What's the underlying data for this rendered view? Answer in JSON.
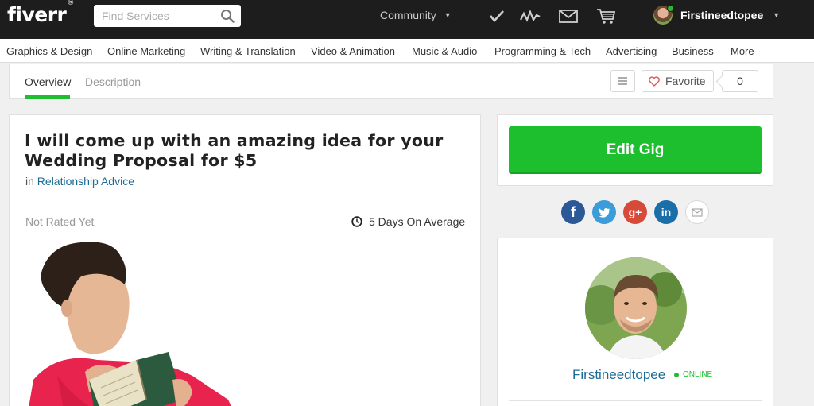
{
  "topbar": {
    "logo": "fiverr",
    "logo_mark": "®",
    "search_placeholder": "Find Services",
    "community": "Community",
    "username": "Firstineedtopee",
    "icons": [
      "search-icon",
      "checkmark-icon",
      "activity-icon",
      "inbox-icon",
      "cart-icon"
    ]
  },
  "categories": [
    "Graphics & Design",
    "Online Marketing",
    "Writing & Translation",
    "Video & Animation",
    "Music & Audio",
    "Programming & Tech",
    "Advertising",
    "Business",
    "More"
  ],
  "tabs": {
    "overview": "Overview",
    "description": "Description",
    "favorite": "Favorite",
    "favorite_count": "0"
  },
  "gig": {
    "title": "I will come up with an amazing idea for your Wedding Proposal for $5",
    "in_label": "in",
    "category": "Relationship Advice",
    "rating": "Not Rated Yet",
    "delivery": "5 Days On Average"
  },
  "sidebar": {
    "edit_button": "Edit Gig",
    "social": {
      "facebook": "f",
      "twitter": "t",
      "google_plus": "g+",
      "linkedin": "in"
    },
    "seller_name": "Firstineedtopee",
    "status": "ONLINE"
  },
  "colors": {
    "topbar_bg": "#1d1d1d",
    "accent_green": "#1dbf2e",
    "link_blue": "#1c6b95",
    "facebook": "#2d5897",
    "twitter": "#3a9cd8",
    "google_plus": "#d74a3a",
    "linkedin": "#1a6fa9"
  }
}
